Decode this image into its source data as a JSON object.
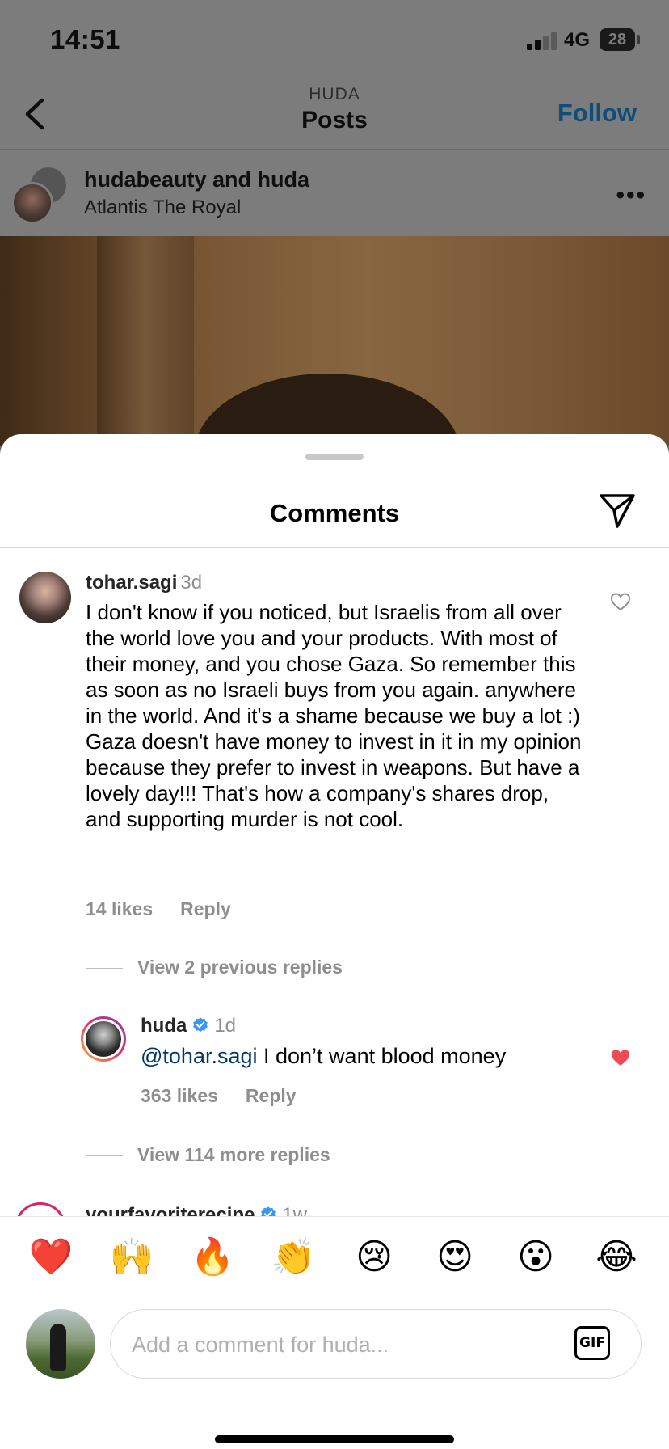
{
  "status_bar": {
    "time": "14:51",
    "network": "4G",
    "battery": "28"
  },
  "nav": {
    "subtitle": "HUDA",
    "title": "Posts",
    "follow_label": "Follow",
    "back_icon": "chevron-left-icon"
  },
  "post": {
    "users": "hudabeauty and huda",
    "location": "Atlantis The Royal",
    "more_icon": "more-horizontal-icon"
  },
  "comments_sheet": {
    "title": "Comments",
    "share_icon": "paper-plane-icon",
    "comment": {
      "user": "tohar.sagi",
      "time": "3d",
      "text": "I don't know if you noticed, but Israelis from all over the world love you and your products. With most of their money, and you chose Gaza. So remember this as soon as no Israeli buys from you again. anywhere in the world. And it's a shame because we buy a lot :) Gaza doesn't have money to invest in it in my opinion because they prefer to invest in weapons. But have a lovely day!!! That's how a company's shares drop, and supporting murder is not cool.",
      "likes": "14 likes",
      "reply_label": "Reply",
      "liked": false
    },
    "view_previous_replies": "View 2 previous replies",
    "reply": {
      "user": "huda",
      "verified": true,
      "time": "1d",
      "mention": "@tohar.sagi",
      "text": " I don’t want blood money",
      "likes": "363 likes",
      "reply_label": "Reply",
      "liked": true,
      "like_color": "#ed4956"
    },
    "view_more_replies": "View 114 more replies",
    "next_comment": {
      "user": "yourfavoriterecipe",
      "verified": true,
      "time": "1w"
    }
  },
  "composer": {
    "emojis": [
      "❤️",
      "🙌",
      "🔥",
      "👏",
      "😢",
      "😍",
      "😮",
      "😂"
    ],
    "placeholder": "Add a comment for huda...",
    "gif_label": "GIF"
  },
  "colors": {
    "link": "#00376b",
    "follow": "#0095f6",
    "secondary_text": "#8e8e8e",
    "verified": "#3897f0"
  }
}
